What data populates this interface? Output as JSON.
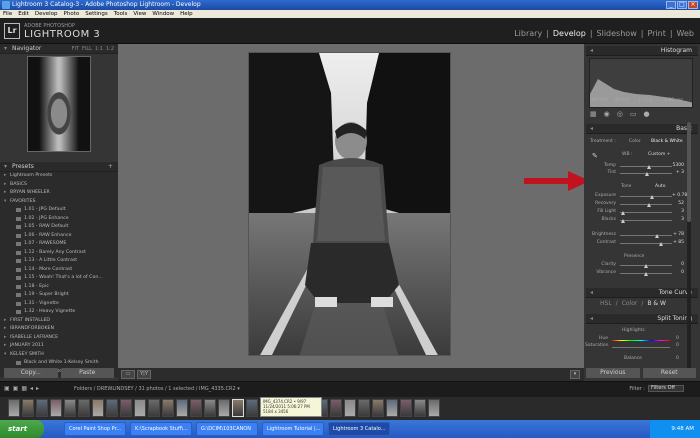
{
  "window": {
    "title": "Lightroom 3 Catalog-3 - Adobe Photoshop Lightroom - Develop"
  },
  "menu": [
    "File",
    "Edit",
    "Develop",
    "Photo",
    "Settings",
    "Tools",
    "View",
    "Window",
    "Help"
  ],
  "identity": {
    "logo": "Lr",
    "brand_small": "ADOBE PHOTOSHOP",
    "brand_big": "LIGHTROOM 3"
  },
  "modules": [
    "Library",
    "|",
    "Develop",
    "|",
    "Slideshow",
    "|",
    "Print",
    "|",
    "Web"
  ],
  "navigator": {
    "title": "Navigator",
    "options": [
      "FIT",
      "FILL",
      "1:1",
      "1:2"
    ]
  },
  "presets": {
    "title": "Presets",
    "rows": [
      {
        "t": "Lightroom Presets",
        "k": "folder"
      },
      {
        "t": "BASICS",
        "k": "folder"
      },
      {
        "t": "BRYAN WHEELER",
        "k": "folder"
      },
      {
        "t": "FAVORITES",
        "k": "folder open"
      },
      {
        "t": "1.01 - JPG Default",
        "k": "item"
      },
      {
        "t": "1.02 - JPG Enhance",
        "k": "item"
      },
      {
        "t": "1.05 - RAW Default",
        "k": "item"
      },
      {
        "t": "1.06 - RAW Enhance",
        "k": "item"
      },
      {
        "t": "1.07 - RAWESOME",
        "k": "item"
      },
      {
        "t": "1.12 - Barely Any Contrast",
        "k": "item"
      },
      {
        "t": "1.13 - A Little Contrast",
        "k": "item"
      },
      {
        "t": "1.14 - More Contrast",
        "k": "item"
      },
      {
        "t": "1.15 - Woah! That's a lot of Con...",
        "k": "item"
      },
      {
        "t": "1.18 - Epic",
        "k": "item"
      },
      {
        "t": "1.19 - Super Bright",
        "k": "item"
      },
      {
        "t": "1.31 - Vignette",
        "k": "item"
      },
      {
        "t": "1.32 - Heavy Vignette",
        "k": "item"
      },
      {
        "t": "FIRST INSTALLED",
        "k": "folder"
      },
      {
        "t": "IBRANDFORBOKEN",
        "k": "folder"
      },
      {
        "t": "ISABELLE LAFRANCE",
        "k": "folder"
      },
      {
        "t": "JANUARY 2011",
        "k": "folder"
      },
      {
        "t": "KELSEY SMITH",
        "k": "folder open"
      },
      {
        "t": "Black and White 1-Kelsey Smith",
        "k": "item"
      },
      {
        "t": "Black and White 5-Kelsey Smith",
        "k": "item"
      }
    ]
  },
  "left_buttons": {
    "copy": "Copy...",
    "paste": "Paste"
  },
  "right": {
    "histogram_title": "Histogram",
    "histo_info": [
      "ISO 400",
      "35 mm",
      "ƒ / 2.0",
      "1/30 sec"
    ],
    "basic_title": "Basic",
    "treatment_label": "Treatment :",
    "treatment_color": "Color",
    "treatment_bw": "Black & White",
    "wb_label": "WB :",
    "wb_value": "Custom ÷",
    "temp": {
      "label": "Temp",
      "value": "5300",
      "pos": 0.55
    },
    "tint": {
      "label": "Tint",
      "value": "+ 3",
      "pos": 0.52
    },
    "tone_label": "Tone",
    "tone_auto": "Auto",
    "tone_rows": [
      {
        "label": "Exposure",
        "value": "+ 0.78",
        "pos": 0.62
      },
      {
        "label": "Recovery",
        "value": "52",
        "pos": 0.55
      },
      {
        "label": "Fill Light",
        "value": "3",
        "pos": 0.05
      },
      {
        "label": "Blacks",
        "value": "3",
        "pos": 0.05
      }
    ],
    "presence_rows": [
      {
        "label": "Brightness",
        "value": "+ 78",
        "pos": 0.72
      },
      {
        "label": "Contrast",
        "value": "+ 85",
        "pos": 0.78
      }
    ],
    "presence_label": "Presence",
    "presence2_rows": [
      {
        "label": "Clarity",
        "value": "0",
        "pos": 0.5
      },
      {
        "label": "Vibrance",
        "value": "0",
        "pos": 0.5
      }
    ],
    "tone_curve_title": "Tone Curve",
    "hsl_tabs": [
      "HSL",
      "/",
      "Color",
      "/",
      "B & W"
    ],
    "split_title": "Split Toning",
    "highlights": "Highlights",
    "hue": "Hue",
    "saturation": "Saturation",
    "balance": "Balance",
    "hue_val": "0",
    "sat_val": "0",
    "bal_val": "0",
    "previous": "Previous",
    "reset": "Reset"
  },
  "filmstrip": {
    "path": "Folders / DREWLINDSEY / 31 photos / 1 selected / IMG_4335.CR2 ▾",
    "filter_label": "Filter :",
    "filter_value": "Filters Off",
    "tooltip": [
      "IMG_4374.CR2 • 9/97",
      "11/24/2011 5:06:27 PM",
      "5184 x 3456"
    ]
  },
  "taskbar": {
    "start": "start",
    "tasks": [
      "Corel Paint Shop Pr...",
      "K:\\Scrapbook Stuff\\...",
      "G:\\DCIM\\103CANON",
      "Lightroom Tutorial |...",
      "Lightroom 3 Catalo..."
    ],
    "clock": "9:48 AM"
  }
}
